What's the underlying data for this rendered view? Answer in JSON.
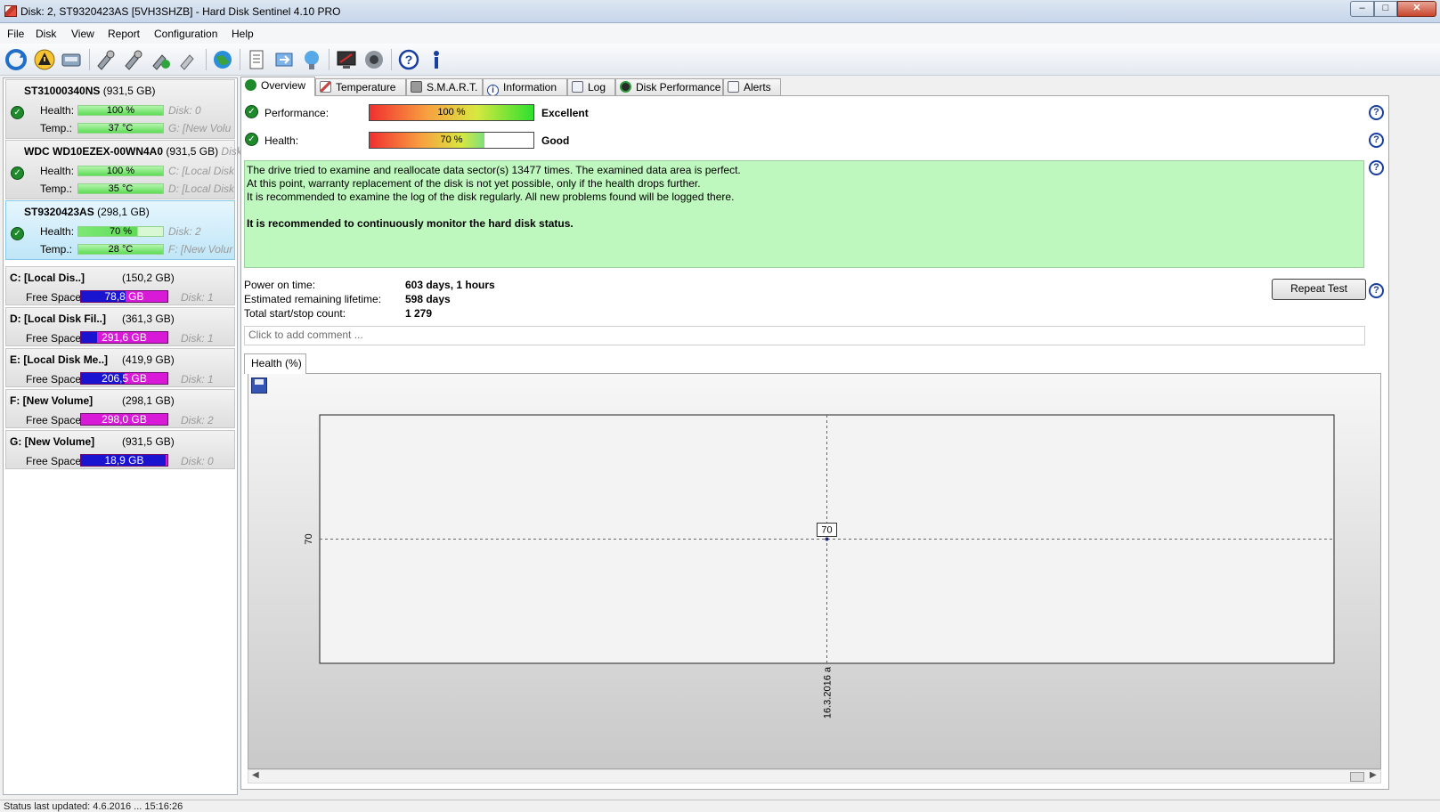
{
  "window": {
    "title": "Disk: 2, ST9320423AS [5VH3SHZB]  -  Hard Disk Sentinel 4.10 PRO"
  },
  "menu": [
    "File",
    "Disk",
    "View",
    "Report",
    "Configuration",
    "Help"
  ],
  "disks": [
    {
      "name": "ST31000340NS",
      "size": "(931,5 GB)",
      "health_label": "Health:",
      "health": "100 %",
      "health_value": 100,
      "temp_label": "Temp.:",
      "temp": "37 °C",
      "right1": "Disk: 0",
      "right2": "G: [New Volu"
    },
    {
      "name": "WDC WD10EZEX-00WN4A0",
      "size": "(931,5 GB)",
      "extra": "Disk",
      "health_label": "Health:",
      "health": "100 %",
      "health_value": 100,
      "temp_label": "Temp.:",
      "temp": "35 °C",
      "right1": "C: [Local Disk",
      "right2": "D: [Local Disk"
    },
    {
      "name": "ST9320423AS",
      "size": "(298,1 GB)",
      "health_label": "Health:",
      "health": "70 %",
      "health_value": 70,
      "temp_label": "Temp.:",
      "temp": "28 °C",
      "right1": "Disk: 2",
      "right2": "F: [New Volur"
    }
  ],
  "volumes": [
    {
      "name": "C: [Local Dis..]",
      "size": "(150,2 GB)",
      "free_label": "Free Space",
      "free": "78,8 GB",
      "free_fraction": 0.52,
      "disk": "Disk: 1"
    },
    {
      "name": "D: [Local Disk Fil..]",
      "size": "(361,3 GB)",
      "free_label": "Free Space",
      "free": "291,6 GB",
      "free_fraction": 0.19,
      "disk": "Disk: 1"
    },
    {
      "name": "E: [Local Disk Me..]",
      "size": "(419,9 GB)",
      "free_label": "Free Space",
      "free": "206,5 GB",
      "free_fraction": 0.51,
      "disk": "Disk: 1"
    },
    {
      "name": "F: [New Volume]",
      "size": "(298,1 GB)",
      "free_label": "Free Space",
      "free": "298,0 GB",
      "free_fraction": 0.0,
      "disk": "Disk: 2"
    },
    {
      "name": "G: [New Volume]",
      "size": "(931,5 GB)",
      "free_label": "Free Space",
      "free": "18,9 GB",
      "free_fraction": 0.98,
      "disk": "Disk: 0"
    }
  ],
  "tabs": [
    "Overview",
    "Temperature",
    "S.M.A.R.T.",
    "Information",
    "Log",
    "Disk Performance",
    "Alerts"
  ],
  "overview": {
    "performance_label": "Performance:",
    "performance": "100 %",
    "performance_value": 100,
    "performance_rating": "Excellent",
    "health_label": "Health:",
    "health": "70 %",
    "health_value": 70,
    "health_rating": "Good",
    "message": {
      "line1": "The drive tried to examine and reallocate data sector(s) 13477 times. The examined data area is perfect.",
      "line2": "At this point, warranty replacement of the disk is not yet possible, only if the health drops further.",
      "line3": "It is recommended to examine the log of the disk regularly. All new problems found will be logged there.",
      "line4": "It is recommended to continuously monitor the hard disk status."
    },
    "stats": {
      "power_on_label": "Power on time:",
      "power_on": "603 days, 1 hours",
      "remaining_label": "Estimated remaining lifetime:",
      "remaining": "598 days",
      "startstop_label": "Total start/stop count:",
      "startstop": "1 279"
    },
    "repeat_test": "Repeat Test",
    "comment_placeholder": "Click to add comment ..."
  },
  "chart_tab": "Health (%)",
  "chart_data": {
    "type": "line",
    "title": "Health (%)",
    "x": [
      "16.3.2016 a"
    ],
    "series": [
      {
        "values": [
          70
        ]
      }
    ],
    "y_ticks": [
      70
    ],
    "point_labels": [
      "70"
    ],
    "grid": true
  },
  "status_text": "Status last updated: 4.6.2016 ...  15:16:26",
  "colors": {
    "health_green": "#5fdc56",
    "message_bg": "#bff8bf",
    "free_space_used": "#d81ad8",
    "free_space_fill": "#1a14d0"
  }
}
